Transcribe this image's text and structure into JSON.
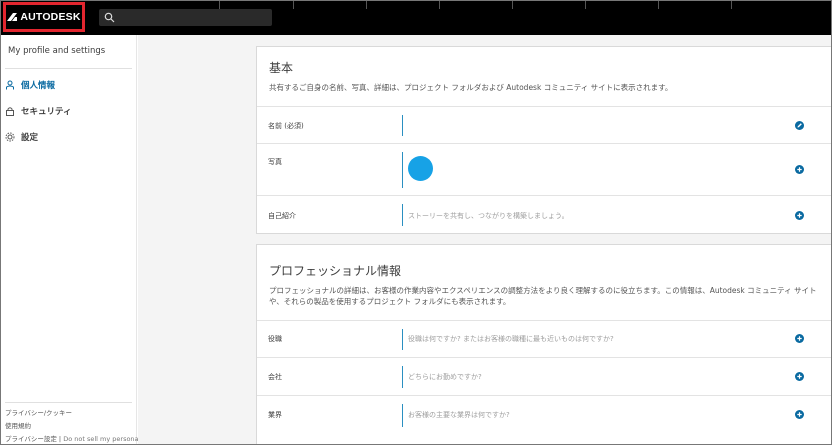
{
  "brand": {
    "name": "AUTODESK"
  },
  "search": {
    "placeholder": ""
  },
  "sidebar": {
    "heading": "My profile and settings",
    "items": [
      {
        "label": "個人情報",
        "icon": "person-icon",
        "active": true
      },
      {
        "label": "セキュリティ",
        "icon": "lock-icon",
        "active": false
      },
      {
        "label": "設定",
        "icon": "gear-icon",
        "active": false
      }
    ],
    "footer": {
      "privacy_cookies": "プライバシー/クッキー",
      "terms": "使用規約",
      "privacy_settings": "プライバシー設定 | ",
      "do_not_sell": "Do not sell my personal"
    }
  },
  "basic": {
    "title": "基本",
    "description": "共有するご自身の名前、写真、詳細は、プロジェクト フォルダおよび Autodesk コミュニティ サイトに表示されます。",
    "rows": [
      {
        "label": "名前 (必須)",
        "value": "",
        "action": "edit-icon"
      },
      {
        "label": "写真",
        "value": "",
        "action": "add-icon"
      },
      {
        "label": "自己紹介",
        "value": "ストーリーを共有し、つながりを構築しましょう。",
        "action": "add-icon"
      }
    ]
  },
  "professional": {
    "title": "プロフェッショナル情報",
    "description": "プロフェッショナルの詳細は、お客様の作業内容やエクスペリエンスの調整方法をより良く理解するのに役立ちます。この情報は、Autodesk コミュニティ サイトや、それらの製品を使用するプロジェクト フォルダにも表示されます。",
    "rows": [
      {
        "label": "役職",
        "value": "役職は何ですか? またはお客様の職種に最も近いものは何ですか?",
        "action": "add-icon"
      },
      {
        "label": "会社",
        "value": "どちらにお勤めですか?",
        "action": "add-icon"
      },
      {
        "label": "業界",
        "value": "お客様の主要な業界は何ですか?",
        "action": "add-icon"
      }
    ]
  },
  "colors": {
    "accent": "#0a6aa1",
    "avatar": "#17a2e6",
    "logo_highlight": "#e3262f"
  }
}
